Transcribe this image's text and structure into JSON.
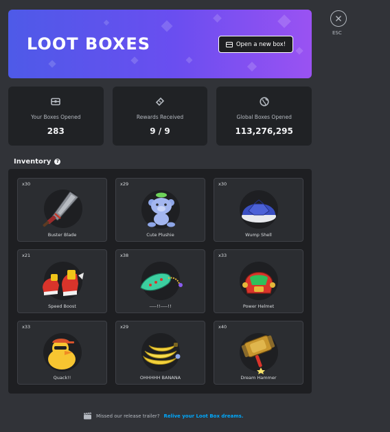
{
  "banner": {
    "title": "LOOT BOXES",
    "open_button": "Open a new box!"
  },
  "stats": [
    {
      "icon": "box-icon",
      "label": "Your Boxes Opened",
      "value": "283"
    },
    {
      "icon": "ticket-icon",
      "label": "Rewards Received",
      "value": "9 / 9"
    },
    {
      "icon": "globe-icon",
      "label": "Global Boxes Opened",
      "value": "113,276,295"
    }
  ],
  "inventory": {
    "title": "Inventory",
    "items": [
      {
        "qty": "x30",
        "name": "Buster Blade",
        "icon": "sword-icon"
      },
      {
        "qty": "x29",
        "name": "Cute Plushie",
        "icon": "plushie-icon"
      },
      {
        "qty": "x30",
        "name": "Wump Shell",
        "icon": "shell-icon"
      },
      {
        "qty": "x21",
        "name": "Speed Boost",
        "icon": "sneakers-icon"
      },
      {
        "qty": "x38",
        "name": "⸺!!⸺!!",
        "icon": "ocarina-icon"
      },
      {
        "qty": "x33",
        "name": "Power Helmet",
        "icon": "helmet-icon"
      },
      {
        "qty": "x33",
        "name": "Quack!!",
        "icon": "duck-icon"
      },
      {
        "qty": "x29",
        "name": "OHHHHH BANANA",
        "icon": "banana-icon"
      },
      {
        "qty": "x40",
        "name": "Dream Hammer",
        "icon": "hammer-icon"
      }
    ]
  },
  "esc": {
    "label": "ESC"
  },
  "footer": {
    "text": "Missed our release trailer?",
    "link": "Relive your Loot Box dreams."
  },
  "colors": {
    "accent": "#5865f2",
    "link": "#00a8fc",
    "banner_start": "#4e5ae8",
    "banner_end": "#9a52f2"
  }
}
